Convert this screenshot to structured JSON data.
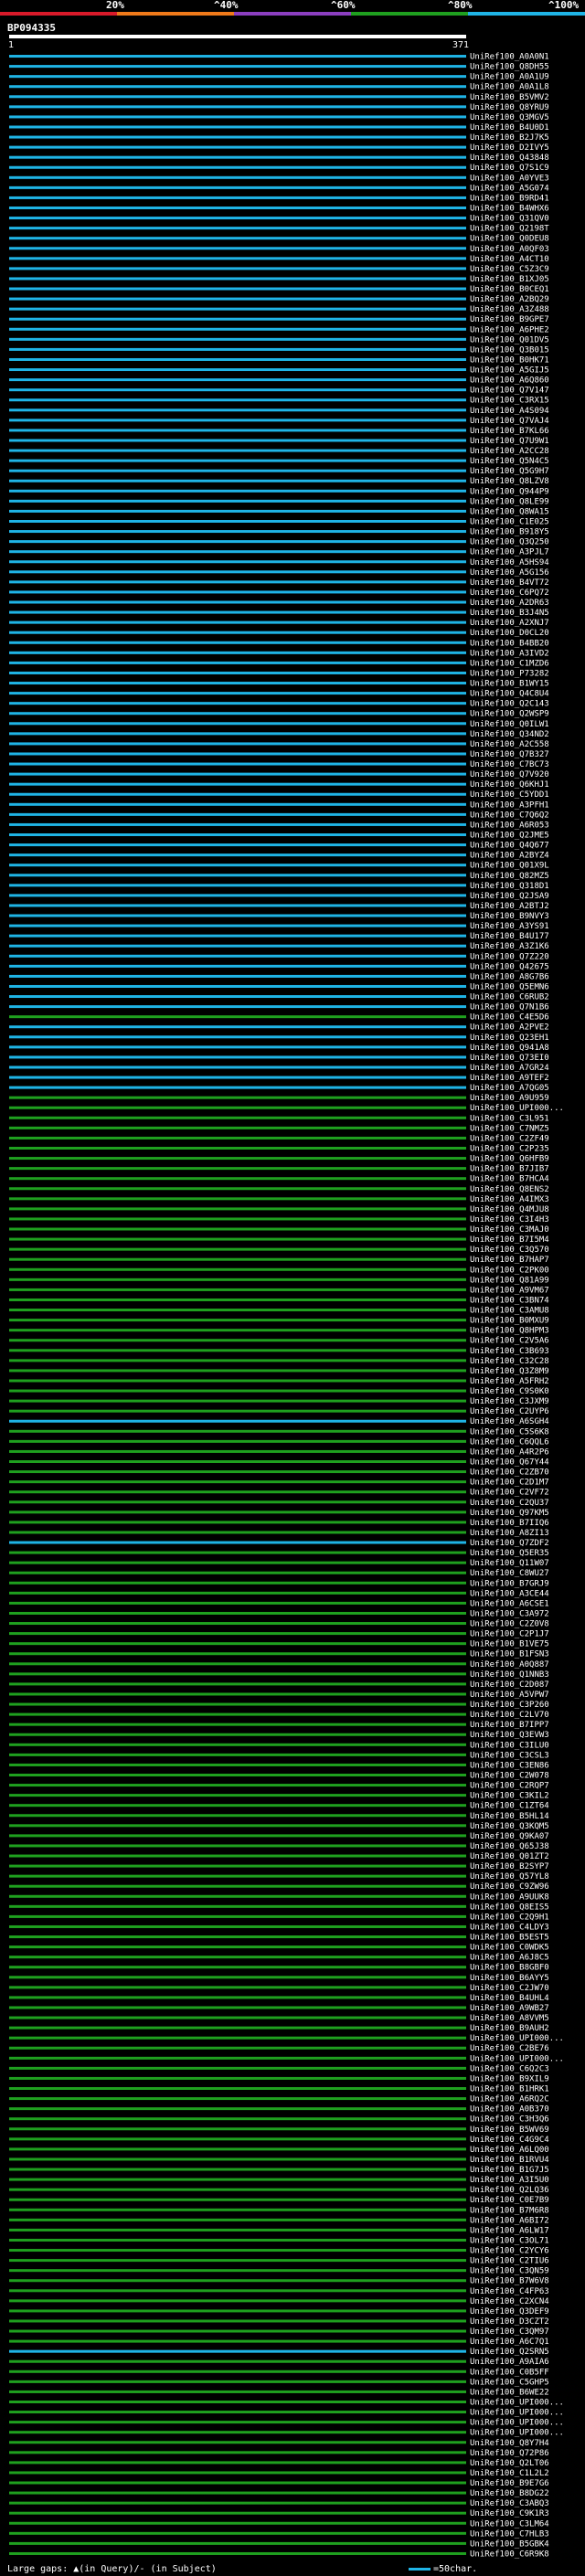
{
  "scale": {
    "ticks": [
      "20%",
      "^40%",
      "^60%",
      "^80%",
      "^100%"
    ],
    "colors": [
      "#d91a2a",
      "#f07a1a",
      "#8c3fc0",
      "#1fa01f",
      "#1fb4e6"
    ]
  },
  "query": {
    "id": "BP094335",
    "start": "1",
    "end": "371"
  },
  "legend": {
    "gaps_text": "Large gaps: ▲(in Query)/- (in Subject)",
    "scale_text": "=50char."
  },
  "chart_data": {
    "type": "alignment-overview",
    "query_length": 371,
    "identity_bins": [
      {
        "label": "<20%",
        "color": "#d91a2a"
      },
      {
        "label": "20-40%",
        "color": "#f07a1a"
      },
      {
        "label": "40-60%",
        "color": "#8c3fc0"
      },
      {
        "label": "60-80%",
        "color": "#1fa01f"
      },
      {
        "label": "80-100%",
        "color": "#1fb4e6"
      }
    ],
    "hits": [
      {
        "label": "UniRef100_A0A0N1",
        "bin": 4
      },
      {
        "label": "UniRef100_Q8DH55",
        "bin": 4
      },
      {
        "label": "UniRef100_A0A1U9",
        "bin": 4
      },
      {
        "label": "UniRef100_A0A1L8",
        "bin": 4
      },
      {
        "label": "UniRef100_B5VMV2",
        "bin": 4
      },
      {
        "label": "UniRef100_Q8YRU9",
        "bin": 4
      },
      {
        "label": "UniRef100_Q3MGV5",
        "bin": 4
      },
      {
        "label": "UniRef100_B4U0D1",
        "bin": 4
      },
      {
        "label": "UniRef100_B2J7K5",
        "bin": 4
      },
      {
        "label": "UniRef100_D2IVY5",
        "bin": 4
      },
      {
        "label": "UniRef100_Q43848",
        "bin": 4
      },
      {
        "label": "UniRef100_Q7S1C9",
        "bin": 4
      },
      {
        "label": "UniRef100_A0YVE3",
        "bin": 4
      },
      {
        "label": "UniRef100_A5G074",
        "bin": 4
      },
      {
        "label": "UniRef100_B9RD41",
        "bin": 4
      },
      {
        "label": "UniRef100_B4WHX6",
        "bin": 4
      },
      {
        "label": "UniRef100_Q31QV0",
        "bin": 4
      },
      {
        "label": "UniRef100_Q2198T",
        "bin": 4
      },
      {
        "label": "UniRef100_Q0DEU8",
        "bin": 4
      },
      {
        "label": "UniRef100_A0QF03",
        "bin": 4
      },
      {
        "label": "UniRef100_A4CT10",
        "bin": 4
      },
      {
        "label": "UniRef100_C5Z3C9",
        "bin": 4
      },
      {
        "label": "UniRef100_B1XJ05",
        "bin": 4
      },
      {
        "label": "UniRef100_B0CEQ1",
        "bin": 4
      },
      {
        "label": "UniRef100_A2BQ29",
        "bin": 4
      },
      {
        "label": "UniRef100_A3Z488",
        "bin": 4
      },
      {
        "label": "UniRef100_B9GPE7",
        "bin": 4
      },
      {
        "label": "UniRef100_A6PHE2",
        "bin": 4
      },
      {
        "label": "UniRef100_Q01DV5",
        "bin": 4
      },
      {
        "label": "UniRef100_Q3B015",
        "bin": 4
      },
      {
        "label": "UniRef100_B0HK71",
        "bin": 4
      },
      {
        "label": "UniRef100_A5GIJ5",
        "bin": 4
      },
      {
        "label": "UniRef100_A6Q860",
        "bin": 4
      },
      {
        "label": "UniRef100_Q7V147",
        "bin": 4
      },
      {
        "label": "UniRef100_C3RX15",
        "bin": 4
      },
      {
        "label": "UniRef100_A4S094",
        "bin": 4
      },
      {
        "label": "UniRef100_Q7VAJ4",
        "bin": 4
      },
      {
        "label": "UniRef100_B7KL66",
        "bin": 4
      },
      {
        "label": "UniRef100_Q7U9W1",
        "bin": 4
      },
      {
        "label": "UniRef100_A2CC28",
        "bin": 4
      },
      {
        "label": "UniRef100_Q5N4C5",
        "bin": 4
      },
      {
        "label": "UniRef100_Q5G9H7",
        "bin": 4
      },
      {
        "label": "UniRef100_Q8LZV8",
        "bin": 4
      },
      {
        "label": "UniRef100_Q944P9",
        "bin": 4
      },
      {
        "label": "UniRef100_Q8LE99",
        "bin": 4
      },
      {
        "label": "UniRef100_Q8WA15",
        "bin": 4
      },
      {
        "label": "UniRef100_C1E025",
        "bin": 4
      },
      {
        "label": "UniRef100_B918Y5",
        "bin": 4
      },
      {
        "label": "UniRef100_Q3Q250",
        "bin": 4
      },
      {
        "label": "UniRef100_A3PJL7",
        "bin": 4
      },
      {
        "label": "UniRef100_A5HS94",
        "bin": 4
      },
      {
        "label": "UniRef100_A5G156",
        "bin": 4
      },
      {
        "label": "UniRef100_B4VT72",
        "bin": 4
      },
      {
        "label": "UniRef100_C6PQ72",
        "bin": 4
      },
      {
        "label": "UniRef100_A2DR63",
        "bin": 4
      },
      {
        "label": "UniRef100_B3J4N5",
        "bin": 4
      },
      {
        "label": "UniRef100_A2XNJ7",
        "bin": 4
      },
      {
        "label": "UniRef100_D0CL20",
        "bin": 4
      },
      {
        "label": "UniRef100_B4BB20",
        "bin": 4
      },
      {
        "label": "UniRef100_A3IVD2",
        "bin": 4
      },
      {
        "label": "UniRef100_C1MZD6",
        "bin": 4
      },
      {
        "label": "UniRef100_P73282",
        "bin": 4
      },
      {
        "label": "UniRef100_B1WY15",
        "bin": 4
      },
      {
        "label": "UniRef100_Q4C8U4",
        "bin": 4
      },
      {
        "label": "UniRef100_Q2C143",
        "bin": 4
      },
      {
        "label": "UniRef100_Q2WSP9",
        "bin": 4
      },
      {
        "label": "UniRef100_Q0ILW1",
        "bin": 4
      },
      {
        "label": "UniRef100_Q34ND2",
        "bin": 4
      },
      {
        "label": "UniRef100_A2C558",
        "bin": 4
      },
      {
        "label": "UniRef100_Q7B327",
        "bin": 4
      },
      {
        "label": "UniRef100_C7BC73",
        "bin": 4
      },
      {
        "label": "UniRef100_Q7V920",
        "bin": 4
      },
      {
        "label": "UniRef100_Q6KHJ1",
        "bin": 4
      },
      {
        "label": "UniRef100_C5YDD1",
        "bin": 4
      },
      {
        "label": "UniRef100_A3PFH1",
        "bin": 4
      },
      {
        "label": "UniRef100_C7Q6Q2",
        "bin": 4
      },
      {
        "label": "UniRef100_A6R053",
        "bin": 4
      },
      {
        "label": "UniRef100_Q2JME5",
        "bin": 4
      },
      {
        "label": "UniRef100_Q4Q677",
        "bin": 4
      },
      {
        "label": "UniRef100_A2BYZ4",
        "bin": 4
      },
      {
        "label": "UniRef100_Q01X9L",
        "bin": 4
      },
      {
        "label": "UniRef100_Q82MZ5",
        "bin": 4
      },
      {
        "label": "UniRef100_Q318D1",
        "bin": 4
      },
      {
        "label": "UniRef100_Q2JSA9",
        "bin": 4
      },
      {
        "label": "UniRef100_A2BTJ2",
        "bin": 4
      },
      {
        "label": "UniRef100_B9NVY3",
        "bin": 4
      },
      {
        "label": "UniRef100_A3YS91",
        "bin": 4
      },
      {
        "label": "UniRef100_B4U177",
        "bin": 4
      },
      {
        "label": "UniRef100_A3Z1K6",
        "bin": 4
      },
      {
        "label": "UniRef100_Q7Z220",
        "bin": 4
      },
      {
        "label": "UniRef100_Q42675",
        "bin": 4
      },
      {
        "label": "UniRef100_A8G7B6",
        "bin": 4
      },
      {
        "label": "UniRef100_Q5EMN6",
        "bin": 4
      },
      {
        "label": "UniRef100_C6RUB2",
        "bin": 4
      },
      {
        "label": "UniRef100_Q7N1B6",
        "bin": 4
      },
      {
        "label": "UniRef100_C4E5D6",
        "bin": 3
      },
      {
        "label": "UniRef100_A2PVE2",
        "bin": 4
      },
      {
        "label": "UniRef100_Q23EH1",
        "bin": 4
      },
      {
        "label": "UniRef100_Q941A8",
        "bin": 4
      },
      {
        "label": "UniRef100_Q73EI0",
        "bin": 4
      },
      {
        "label": "UniRef100_A7GR24",
        "bin": 4
      },
      {
        "label": "UniRef100_A9TEF2",
        "bin": 4
      },
      {
        "label": "UniRef100_A7QG05",
        "bin": 4
      },
      {
        "label": "UniRef100_A9U959",
        "bin": 3
      },
      {
        "label": "UniRef100_UPI000...",
        "bin": 3
      },
      {
        "label": "UniRef100_C3L951",
        "bin": 3
      },
      {
        "label": "UniRef100_C7NMZ5",
        "bin": 3
      },
      {
        "label": "UniRef100_C2ZF49",
        "bin": 3
      },
      {
        "label": "UniRef100_C2P235",
        "bin": 3
      },
      {
        "label": "UniRef100_Q6HFB9",
        "bin": 3
      },
      {
        "label": "UniRef100_B7JIB7",
        "bin": 3
      },
      {
        "label": "UniRef100_B7HCA4",
        "bin": 3
      },
      {
        "label": "UniRef100_Q8ENS2",
        "bin": 3
      },
      {
        "label": "UniRef100_A4IMX3",
        "bin": 3
      },
      {
        "label": "UniRef100_Q4MJU8",
        "bin": 3
      },
      {
        "label": "UniRef100_C3I4H3",
        "bin": 3
      },
      {
        "label": "UniRef100_C3MAJ0",
        "bin": 3
      },
      {
        "label": "UniRef100_B7I5M4",
        "bin": 3
      },
      {
        "label": "UniRef100_C3Q570",
        "bin": 3
      },
      {
        "label": "UniRef100_B7HAP7",
        "bin": 3
      },
      {
        "label": "UniRef100_C2PK00",
        "bin": 3
      },
      {
        "label": "UniRef100_Q81A99",
        "bin": 3
      },
      {
        "label": "UniRef100_A9VM67",
        "bin": 3
      },
      {
        "label": "UniRef100_C3BN74",
        "bin": 3
      },
      {
        "label": "UniRef100_C3AMU8",
        "bin": 3
      },
      {
        "label": "UniRef100_B0MXU9",
        "bin": 3
      },
      {
        "label": "UniRef100_Q8HPM3",
        "bin": 3
      },
      {
        "label": "UniRef100_C2V5A6",
        "bin": 3
      },
      {
        "label": "UniRef100_C3B693",
        "bin": 3
      },
      {
        "label": "UniRef100_C32C28",
        "bin": 3
      },
      {
        "label": "UniRef100_Q3Z8M9",
        "bin": 3
      },
      {
        "label": "UniRef100_A5FRH2",
        "bin": 3
      },
      {
        "label": "UniRef100_C9S0K0",
        "bin": 3
      },
      {
        "label": "UniRef100_C3JXM9",
        "bin": 3
      },
      {
        "label": "UniRef100_C2UYP6",
        "bin": 3
      },
      {
        "label": "UniRef100_A6SGH4",
        "bin": 4
      },
      {
        "label": "UniRef100_C5S6K8",
        "bin": 3
      },
      {
        "label": "UniRef100_C6QQL6",
        "bin": 3
      },
      {
        "label": "UniRef100_A4R2P6",
        "bin": 3
      },
      {
        "label": "UniRef100_Q67Y44",
        "bin": 3
      },
      {
        "label": "UniRef100_C2ZB70",
        "bin": 3
      },
      {
        "label": "UniRef100_C2D1M7",
        "bin": 3
      },
      {
        "label": "UniRef100_C2VF72",
        "bin": 3
      },
      {
        "label": "UniRef100_C2QU37",
        "bin": 3
      },
      {
        "label": "UniRef100_Q97KM5",
        "bin": 3
      },
      {
        "label": "UniRef100_B7IIQ6",
        "bin": 3
      },
      {
        "label": "UniRef100_A8ZI13",
        "bin": 3
      },
      {
        "label": "UniRef100_Q7ZDF2",
        "bin": 4
      },
      {
        "label": "UniRef100_Q5ER35",
        "bin": 3
      },
      {
        "label": "UniRef100_Q11W07",
        "bin": 3
      },
      {
        "label": "UniRef100_C8WU27",
        "bin": 3
      },
      {
        "label": "UniRef100_B7GRJ9",
        "bin": 3
      },
      {
        "label": "UniRef100_A3CE44",
        "bin": 3
      },
      {
        "label": "UniRef100_A6CSE1",
        "bin": 3
      },
      {
        "label": "UniRef100_C3A972",
        "bin": 3
      },
      {
        "label": "UniRef100_C2Z0V8",
        "bin": 3
      },
      {
        "label": "UniRef100_C2P1J7",
        "bin": 3
      },
      {
        "label": "UniRef100_B1VE75",
        "bin": 3
      },
      {
        "label": "UniRef100_B1FSN3",
        "bin": 3
      },
      {
        "label": "UniRef100_A0Q887",
        "bin": 3
      },
      {
        "label": "UniRef100_Q1NNB3",
        "bin": 3
      },
      {
        "label": "UniRef100_C2D087",
        "bin": 3
      },
      {
        "label": "UniRef100_A5VPW7",
        "bin": 3
      },
      {
        "label": "UniRef100_C3P260",
        "bin": 3
      },
      {
        "label": "UniRef100_C2LV70",
        "bin": 3
      },
      {
        "label": "UniRef100_B7IPP7",
        "bin": 3
      },
      {
        "label": "UniRef100_Q3EVW3",
        "bin": 3
      },
      {
        "label": "UniRef100_C3ILU0",
        "bin": 3
      },
      {
        "label": "UniRef100_C3CSL3",
        "bin": 3
      },
      {
        "label": "UniRef100_C3EN86",
        "bin": 3
      },
      {
        "label": "UniRef100_C2W078",
        "bin": 3
      },
      {
        "label": "UniRef100_C2RQP7",
        "bin": 3
      },
      {
        "label": "UniRef100_C3KIL2",
        "bin": 3
      },
      {
        "label": "UniRef100_C1ZT64",
        "bin": 3
      },
      {
        "label": "UniRef100_B5HL14",
        "bin": 3
      },
      {
        "label": "UniRef100_Q3KQM5",
        "bin": 3
      },
      {
        "label": "UniRef100_Q9KA07",
        "bin": 3
      },
      {
        "label": "UniRef100_Q65J38",
        "bin": 3
      },
      {
        "label": "UniRef100_Q01ZT2",
        "bin": 3
      },
      {
        "label": "UniRef100_B2SYP7",
        "bin": 3
      },
      {
        "label": "UniRef100_Q57YL8",
        "bin": 3
      },
      {
        "label": "UniRef100_C9ZW96",
        "bin": 3
      },
      {
        "label": "UniRef100_A9UUK8",
        "bin": 3
      },
      {
        "label": "UniRef100_Q8EIS5",
        "bin": 3
      },
      {
        "label": "UniRef100_C2Q9H1",
        "bin": 3
      },
      {
        "label": "UniRef100_C4LDY3",
        "bin": 3
      },
      {
        "label": "UniRef100_B5EST5",
        "bin": 3
      },
      {
        "label": "UniRef100_C0WDK5",
        "bin": 3
      },
      {
        "label": "UniRef100_A6J8C5",
        "bin": 3
      },
      {
        "label": "UniRef100_B8GBF0",
        "bin": 3
      },
      {
        "label": "UniRef100_B6AYY5",
        "bin": 3
      },
      {
        "label": "UniRef100_C2JW70",
        "bin": 3
      },
      {
        "label": "UniRef100_B4UHL4",
        "bin": 3
      },
      {
        "label": "UniRef100_A9WB27",
        "bin": 3
      },
      {
        "label": "UniRef100_A8VVM5",
        "bin": 3
      },
      {
        "label": "UniRef100_B9AUH2",
        "bin": 3
      },
      {
        "label": "UniRef100_UPI000...",
        "bin": 3
      },
      {
        "label": "UniRef100_C2BE76",
        "bin": 3
      },
      {
        "label": "UniRef100_UPI000...",
        "bin": 3
      },
      {
        "label": "UniRef100_C6Q2C3",
        "bin": 3
      },
      {
        "label": "UniRef100_B9XIL9",
        "bin": 3
      },
      {
        "label": "UniRef100_B1HRK1",
        "bin": 3
      },
      {
        "label": "UniRef100_A6RQ2C",
        "bin": 3
      },
      {
        "label": "UniRef100_A0B370",
        "bin": 3
      },
      {
        "label": "UniRef100_C3H3Q6",
        "bin": 3
      },
      {
        "label": "UniRef100_B5WV69",
        "bin": 3
      },
      {
        "label": "UniRef100_C4G9C4",
        "bin": 3
      },
      {
        "label": "UniRef100_A6LQ00",
        "bin": 3
      },
      {
        "label": "UniRef100_B1RVU4",
        "bin": 3
      },
      {
        "label": "UniRef100_B1G7J5",
        "bin": 3
      },
      {
        "label": "UniRef100_A3I5U0",
        "bin": 3
      },
      {
        "label": "UniRef100_Q2LQ36",
        "bin": 3
      },
      {
        "label": "UniRef100_C0E7B9",
        "bin": 3
      },
      {
        "label": "UniRef100_B7M6R8",
        "bin": 3
      },
      {
        "label": "UniRef100_A6BI72",
        "bin": 3
      },
      {
        "label": "UniRef100_A6LW17",
        "bin": 3
      },
      {
        "label": "UniRef100_C3OL71",
        "bin": 3
      },
      {
        "label": "UniRef100_C2YCY6",
        "bin": 3
      },
      {
        "label": "UniRef100_C2TIU6",
        "bin": 3
      },
      {
        "label": "UniRef100_C3QN59",
        "bin": 3
      },
      {
        "label": "UniRef100_B7W6V8",
        "bin": 3
      },
      {
        "label": "UniRef100_C4FP63",
        "bin": 3
      },
      {
        "label": "UniRef100_C2XCN4",
        "bin": 3
      },
      {
        "label": "UniRef100_Q3DEF9",
        "bin": 3
      },
      {
        "label": "UniRef100_D3CZT2",
        "bin": 3
      },
      {
        "label": "UniRef100_C3QM97",
        "bin": 3
      },
      {
        "label": "UniRef100_A6C7Q1",
        "bin": 3
      },
      {
        "label": "UniRef100_Q2SRN5",
        "bin": 4
      },
      {
        "label": "UniRef100_A9AIA6",
        "bin": 3
      },
      {
        "label": "UniRef100_C0B5FF",
        "bin": 3
      },
      {
        "label": "UniRef100_C5GHP5",
        "bin": 3
      },
      {
        "label": "UniRef100_B6WE22",
        "bin": 3
      },
      {
        "label": "UniRef100_UPI000...",
        "bin": 3
      },
      {
        "label": "UniRef100_UPI000...",
        "bin": 3
      },
      {
        "label": "UniRef100_UPI000...",
        "bin": 3
      },
      {
        "label": "UniRef100_UPI000...",
        "bin": 3
      },
      {
        "label": "UniRef100_Q8Y7H4",
        "bin": 3
      },
      {
        "label": "UniRef100_Q72P86",
        "bin": 3
      },
      {
        "label": "UniRef100_Q2LT06",
        "bin": 3
      },
      {
        "label": "UniRef100_C1L2L2",
        "bin": 3
      },
      {
        "label": "UniRef100_B9E7G6",
        "bin": 3
      },
      {
        "label": "UniRef100_B8DG22",
        "bin": 3
      },
      {
        "label": "UniRef100_C3ABQ3",
        "bin": 3
      },
      {
        "label": "UniRef100_C9K1R3",
        "bin": 3
      },
      {
        "label": "UniRef100_C3LM64",
        "bin": 3
      },
      {
        "label": "UniRef100_C7HLB3",
        "bin": 3
      },
      {
        "label": "UniRef100_B5GBK4",
        "bin": 3
      },
      {
        "label": "UniRef100_C6R9K8",
        "bin": 3
      }
    ]
  }
}
